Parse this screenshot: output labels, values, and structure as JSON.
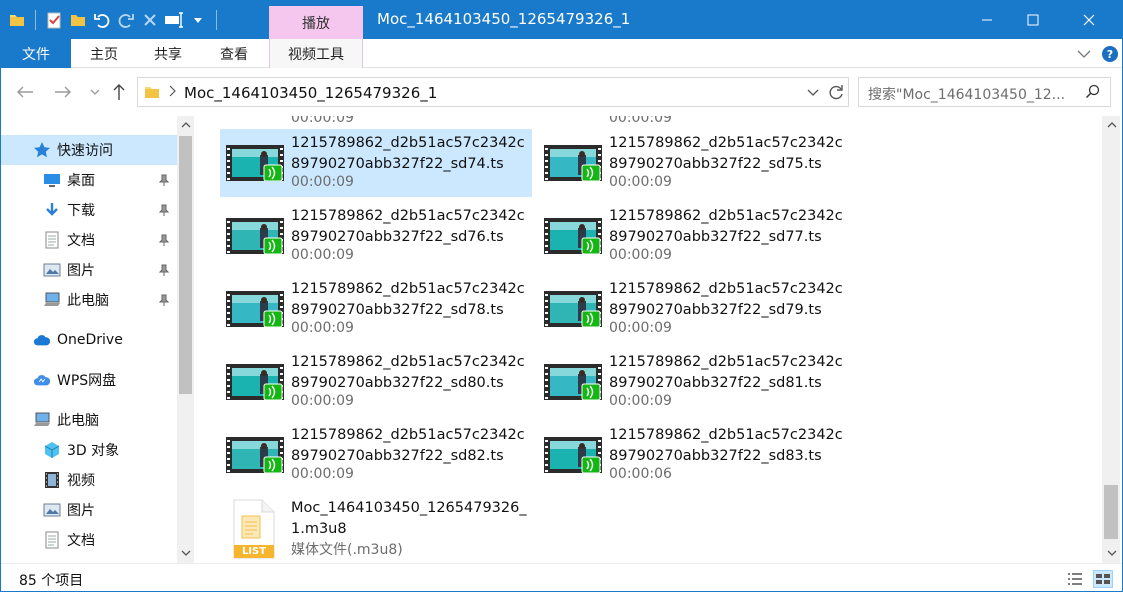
{
  "window": {
    "title": "Moc_1464103450_1265479326_1",
    "context_tab": "播放",
    "accent": "#1979ca"
  },
  "ribbon": {
    "tabs": [
      "文件",
      "主页",
      "共享",
      "查看",
      "视频工具"
    ]
  },
  "address": {
    "path": "Moc_1464103450_1265479326_1",
    "search_placeholder": "搜索\"Moc_1464103450_12..."
  },
  "nav": {
    "items": [
      {
        "label": "快速访问",
        "icon": "star-icon",
        "pinned": false
      },
      {
        "label": "桌面",
        "icon": "desktop-icon",
        "pinned": true
      },
      {
        "label": "下载",
        "icon": "download-icon",
        "pinned": true
      },
      {
        "label": "文档",
        "icon": "document-icon",
        "pinned": true
      },
      {
        "label": "图片",
        "icon": "picture-icon",
        "pinned": true
      },
      {
        "label": "此电脑",
        "icon": "computer-icon",
        "pinned": true
      },
      {
        "label": "OneDrive",
        "icon": "cloud-icon",
        "pinned": false
      },
      {
        "label": "WPS网盘",
        "icon": "wps-cloud-icon",
        "pinned": false
      },
      {
        "label": "此电脑",
        "icon": "computer-icon",
        "pinned": false
      },
      {
        "label": "3D 对象",
        "icon": "cube-icon",
        "pinned": false
      },
      {
        "label": "视频",
        "icon": "video-icon",
        "pinned": false
      },
      {
        "label": "图片",
        "icon": "picture-icon",
        "pinned": false
      },
      {
        "label": "文档",
        "icon": "document-icon",
        "pinned": false
      }
    ]
  },
  "files": [
    {
      "name": "1215789862_d2b51ac57c2342c89790270abb327f22_sd74.ts",
      "duration": "00:00:09",
      "selected": true
    },
    {
      "name": "1215789862_d2b51ac57c2342c89790270abb327f22_sd75.ts",
      "duration": "00:00:09",
      "selected": false
    },
    {
      "name": "1215789862_d2b51ac57c2342c89790270abb327f22_sd76.ts",
      "duration": "00:00:09",
      "selected": false
    },
    {
      "name": "1215789862_d2b51ac57c2342c89790270abb327f22_sd77.ts",
      "duration": "00:00:09",
      "selected": false
    },
    {
      "name": "1215789862_d2b51ac57c2342c89790270abb327f22_sd78.ts",
      "duration": "00:00:09",
      "selected": false
    },
    {
      "name": "1215789862_d2b51ac57c2342c89790270abb327f22_sd79.ts",
      "duration": "00:00:09",
      "selected": false
    },
    {
      "name": "1215789862_d2b51ac57c2342c89790270abb327f22_sd80.ts",
      "duration": "00:00:09",
      "selected": false
    },
    {
      "name": "1215789862_d2b51ac57c2342c89790270abb327f22_sd81.ts",
      "duration": "00:00:09",
      "selected": false
    },
    {
      "name": "1215789862_d2b51ac57c2342c89790270abb327f22_sd82.ts",
      "duration": "00:00:09",
      "selected": false
    },
    {
      "name": "1215789862_d2b51ac57c2342c89790270abb327f22_sd83.ts",
      "duration": "00:00:06",
      "selected": false
    }
  ],
  "list_file": {
    "name": "Moc_1464103450_1265479326_1.m3u8",
    "type": "媒体文件(.m3u8)",
    "badge": "LIST"
  },
  "partial_top_row": [
    "00:00:09",
    "00:00:09"
  ],
  "status": {
    "count": "85 个项目"
  }
}
